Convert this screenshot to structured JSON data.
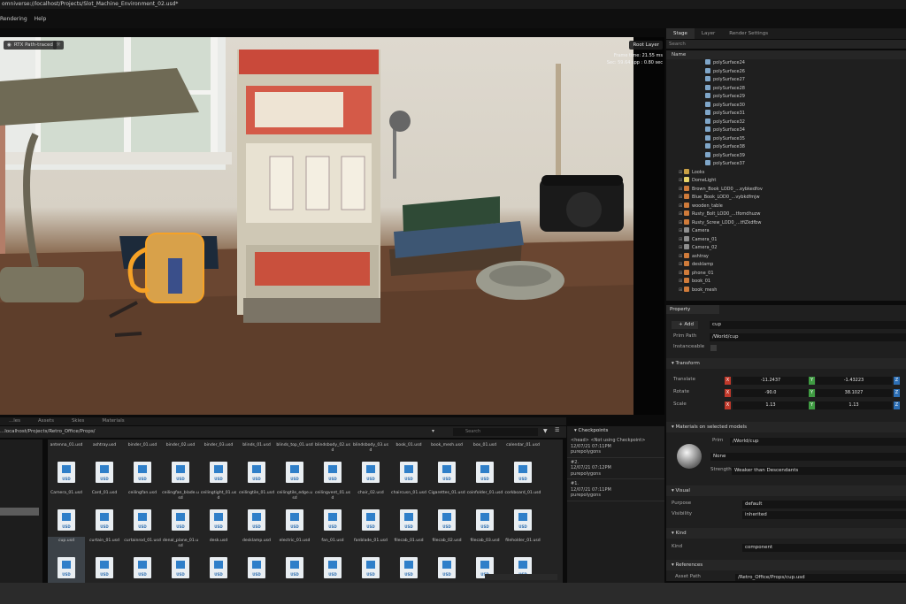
{
  "app": {
    "title": "omniverse://localhost/Projects/Slot_Machine_Environment_02.usd*",
    "menu": [
      "Rendering",
      "Help"
    ]
  },
  "viewport": {
    "renderer": "RTX Path-traced",
    "layer": "Root Layer",
    "stats": [
      "Frame time: 21.55 ms",
      "Sec: 59.64 spp : 0.80 sec"
    ]
  },
  "stage": {
    "tabs": [
      "Stage",
      "Layer",
      "Render Settings"
    ],
    "search_placeholder": "Search",
    "column": "Name",
    "items": [
      {
        "label": "polySurface24",
        "depth": 4,
        "icon": "mesh-icon"
      },
      {
        "label": "polySurface26",
        "depth": 4,
        "icon": "mesh-icon"
      },
      {
        "label": "polySurface27",
        "depth": 4,
        "icon": "mesh-icon"
      },
      {
        "label": "polySurface28",
        "depth": 4,
        "icon": "mesh-icon"
      },
      {
        "label": "polySurface29",
        "depth": 4,
        "icon": "mesh-icon"
      },
      {
        "label": "polySurface30",
        "depth": 4,
        "icon": "mesh-icon"
      },
      {
        "label": "polySurface31",
        "depth": 4,
        "icon": "mesh-icon"
      },
      {
        "label": "polySurface32",
        "depth": 4,
        "icon": "mesh-icon"
      },
      {
        "label": "polySurface34",
        "depth": 4,
        "icon": "mesh-icon"
      },
      {
        "label": "polySurface35",
        "depth": 4,
        "icon": "mesh-icon"
      },
      {
        "label": "polySurface38",
        "depth": 4,
        "icon": "mesh-icon"
      },
      {
        "label": "polySurface39",
        "depth": 4,
        "icon": "mesh-icon"
      },
      {
        "label": "polySurface37",
        "depth": 4,
        "icon": "mesh-icon"
      },
      {
        "label": "Looks",
        "depth": 1,
        "icon": "folder-icon"
      },
      {
        "label": "DomeLight",
        "depth": 1,
        "icon": "light-icon"
      },
      {
        "label": "Brown_Book_LOD0_...xybkedfov",
        "depth": 1,
        "icon": "xform-icon"
      },
      {
        "label": "Blue_Book_LOD0_...vybkdfmjw",
        "depth": 1,
        "icon": "xform-icon"
      },
      {
        "label": "wooden_table",
        "depth": 1,
        "icon": "xform-icon"
      },
      {
        "label": "Rusty_Bolt_LOD0_...tfomdhuzw",
        "depth": 1,
        "icon": "xform-icon"
      },
      {
        "label": "Rusty_Screw_LOD0_...tfiZkdfbw",
        "depth": 1,
        "icon": "xform-icon"
      },
      {
        "label": "Camera",
        "depth": 1,
        "icon": "camera-icon"
      },
      {
        "label": "Camera_01",
        "depth": 1,
        "icon": "camera-icon"
      },
      {
        "label": "Camera_02",
        "depth": 1,
        "icon": "camera-icon"
      },
      {
        "label": "ashtray",
        "depth": 1,
        "icon": "xform-icon"
      },
      {
        "label": "desklamp",
        "depth": 1,
        "icon": "xform-icon"
      },
      {
        "label": "phone_01",
        "depth": 1,
        "icon": "xform-icon"
      },
      {
        "label": "book_01",
        "depth": 1,
        "icon": "xform-icon"
      },
      {
        "label": "book_mesh",
        "depth": 1,
        "icon": "xform-icon"
      }
    ]
  },
  "property": {
    "tab": "Property",
    "add_label": "Add",
    "name_value": "cup",
    "prim_path_label": "Prim Path",
    "prim_path_value": "/World/cup",
    "instanceable_label": "Instanceable",
    "transform_title": "Transform",
    "translate_label": "Translate",
    "rotate_label": "Rotate",
    "scale_label": "Scale",
    "translate": [
      "-11.2437",
      "",
      "-1.43223"
    ],
    "rotate": [
      "-90.0",
      "",
      "38.1027"
    ],
    "scale": [
      "1.13",
      "1.13",
      ""
    ],
    "materials_title": "Materials on selected models",
    "prim_label": "Prim",
    "prim_value": "/World/cup",
    "material_value": "None",
    "strength_label": "Strength",
    "strength_value": "Weaker than Descendants",
    "visual_title": "Visual",
    "purpose_label": "Purpose",
    "purpose_value": "default",
    "visibility_label": "Visibility",
    "visibility_value": "inherited",
    "kind_title": "Kind",
    "kind_label": "Kind",
    "kind_value": "component",
    "references_title": "References",
    "asset_path_label": "Asset Path",
    "asset_path_value": "/Retro_Office/Props/cup.usd"
  },
  "content": {
    "tabs": [
      "...les",
      "Assets",
      "Skies",
      "Materials"
    ],
    "path": "...localhost/Projects/Retro_Office/Props/",
    "search_placeholder": "Search",
    "files": [
      "antenna_01.usd",
      "ashtray.usd",
      "binder_01.usd",
      "binder_02.usd",
      "binder_03.usd",
      "blinds_01.usd",
      "blinds_top_01.usd",
      "blindsbody_02.usd",
      "blindsbody_03.usd",
      "book_01.usd",
      "book_mesh.usd",
      "box_01.usd",
      "calendar_01.usd",
      "Camera_01.usd",
      "Card_01.usd",
      "ceilingfan.usd",
      "ceilingfan_blade.usd",
      "ceilingtight_01.usd",
      "ceilingtile_01.usd",
      "ceilingtile_edge.usd",
      "ceilingvent_01.usd",
      "chair_02.usd",
      "chaircusn_01.usd",
      "Cigarettes_01.usd",
      "coinfolder_01.usd",
      "corkboard_01.usd",
      "cup.usd",
      "curtain_01.usd",
      "curtainrod_01.usd",
      "denal_plane_01.usd",
      "desk.usd",
      "desklamp.usd",
      "electric_01.usd",
      "fan_01.usd",
      "fanblade_01.usd",
      "filecab_01.usd",
      "filecab_02.usd",
      "filecab_03.usd",
      "fileholder_01.usd",
      "",
      "",
      "",
      "",
      "",
      "",
      "",
      "",
      "",
      "",
      "",
      "",
      ""
    ],
    "selected_file": "cup.usd"
  },
  "checkpoints": {
    "title": "Checkpoints",
    "items": [
      {
        "id": "<head>",
        "note": "<Not using Checkpoint>",
        "time": "12/07/21 07:11PM",
        "desc": "purepolygons"
      },
      {
        "id": "#2.",
        "note": "",
        "time": "12/07/21 07:12PM",
        "desc": "purepolygons"
      },
      {
        "id": "#1.",
        "note": "",
        "time": "12/07/21 07:11PM",
        "desc": "purepolygons"
      }
    ]
  },
  "colors": {
    "accent": "#76b900",
    "x_axis": "#c0392b",
    "y_axis": "#3f9b42",
    "z_axis": "#2d6fb5"
  }
}
